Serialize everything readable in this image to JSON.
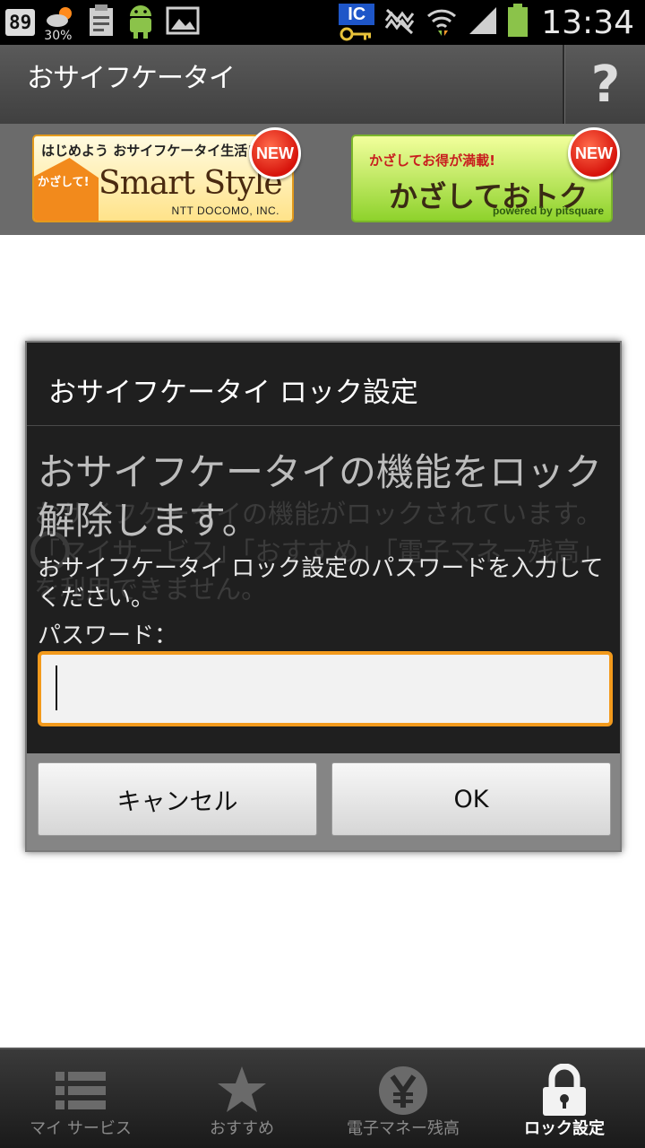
{
  "status_bar": {
    "notification_count": "89",
    "weather_percent": "30%",
    "ic_label": "IC",
    "time": "13:34",
    "icons": [
      "weather-icon",
      "clipboard-icon",
      "android-icon",
      "image-icon",
      "ic-key-icon",
      "mute-icon",
      "wifi-icon",
      "signal-icon",
      "battery-icon"
    ]
  },
  "app": {
    "title": "おサイフケータイ",
    "help_label": "?"
  },
  "banners": [
    {
      "header": "はじめよう おサイフケータイ生活!",
      "tag": "かざして!",
      "main": "Smart Style",
      "sub": "NTT DOCOMO, INC.",
      "badge": "NEW"
    },
    {
      "header": "かざしてお得が満載!",
      "main": "かざしておトク",
      "sub": "powered by pitsquare",
      "badge": "NEW"
    }
  ],
  "background_text": "おサイフケータイの機能がロックされています。「マイサービス」「おすすめ」「電子マネー残高」を利用できません。",
  "dialog": {
    "title": "おサイフケータイ ロック設定",
    "message_large": "おサイフケータイの機能をロック解除します。",
    "message_small": "おサイフケータイ ロック設定のパスワードを入力してください。",
    "password_label": "パスワード：",
    "password_value": "",
    "cancel_label": "キャンセル",
    "ok_label": "OK"
  },
  "tabs": [
    {
      "label": "マイ サービス",
      "icon": "list-icon",
      "active": false
    },
    {
      "label": "おすすめ",
      "icon": "star-icon",
      "active": false
    },
    {
      "label": "電子マネー残高",
      "icon": "yen-icon",
      "active": false
    },
    {
      "label": "ロック設定",
      "icon": "lock-icon",
      "active": true
    }
  ],
  "colors": {
    "accent_orange": "#f39a1c",
    "dialog_bg": "#1f1f1f",
    "tabbar_bg": "#2a2a2a"
  }
}
